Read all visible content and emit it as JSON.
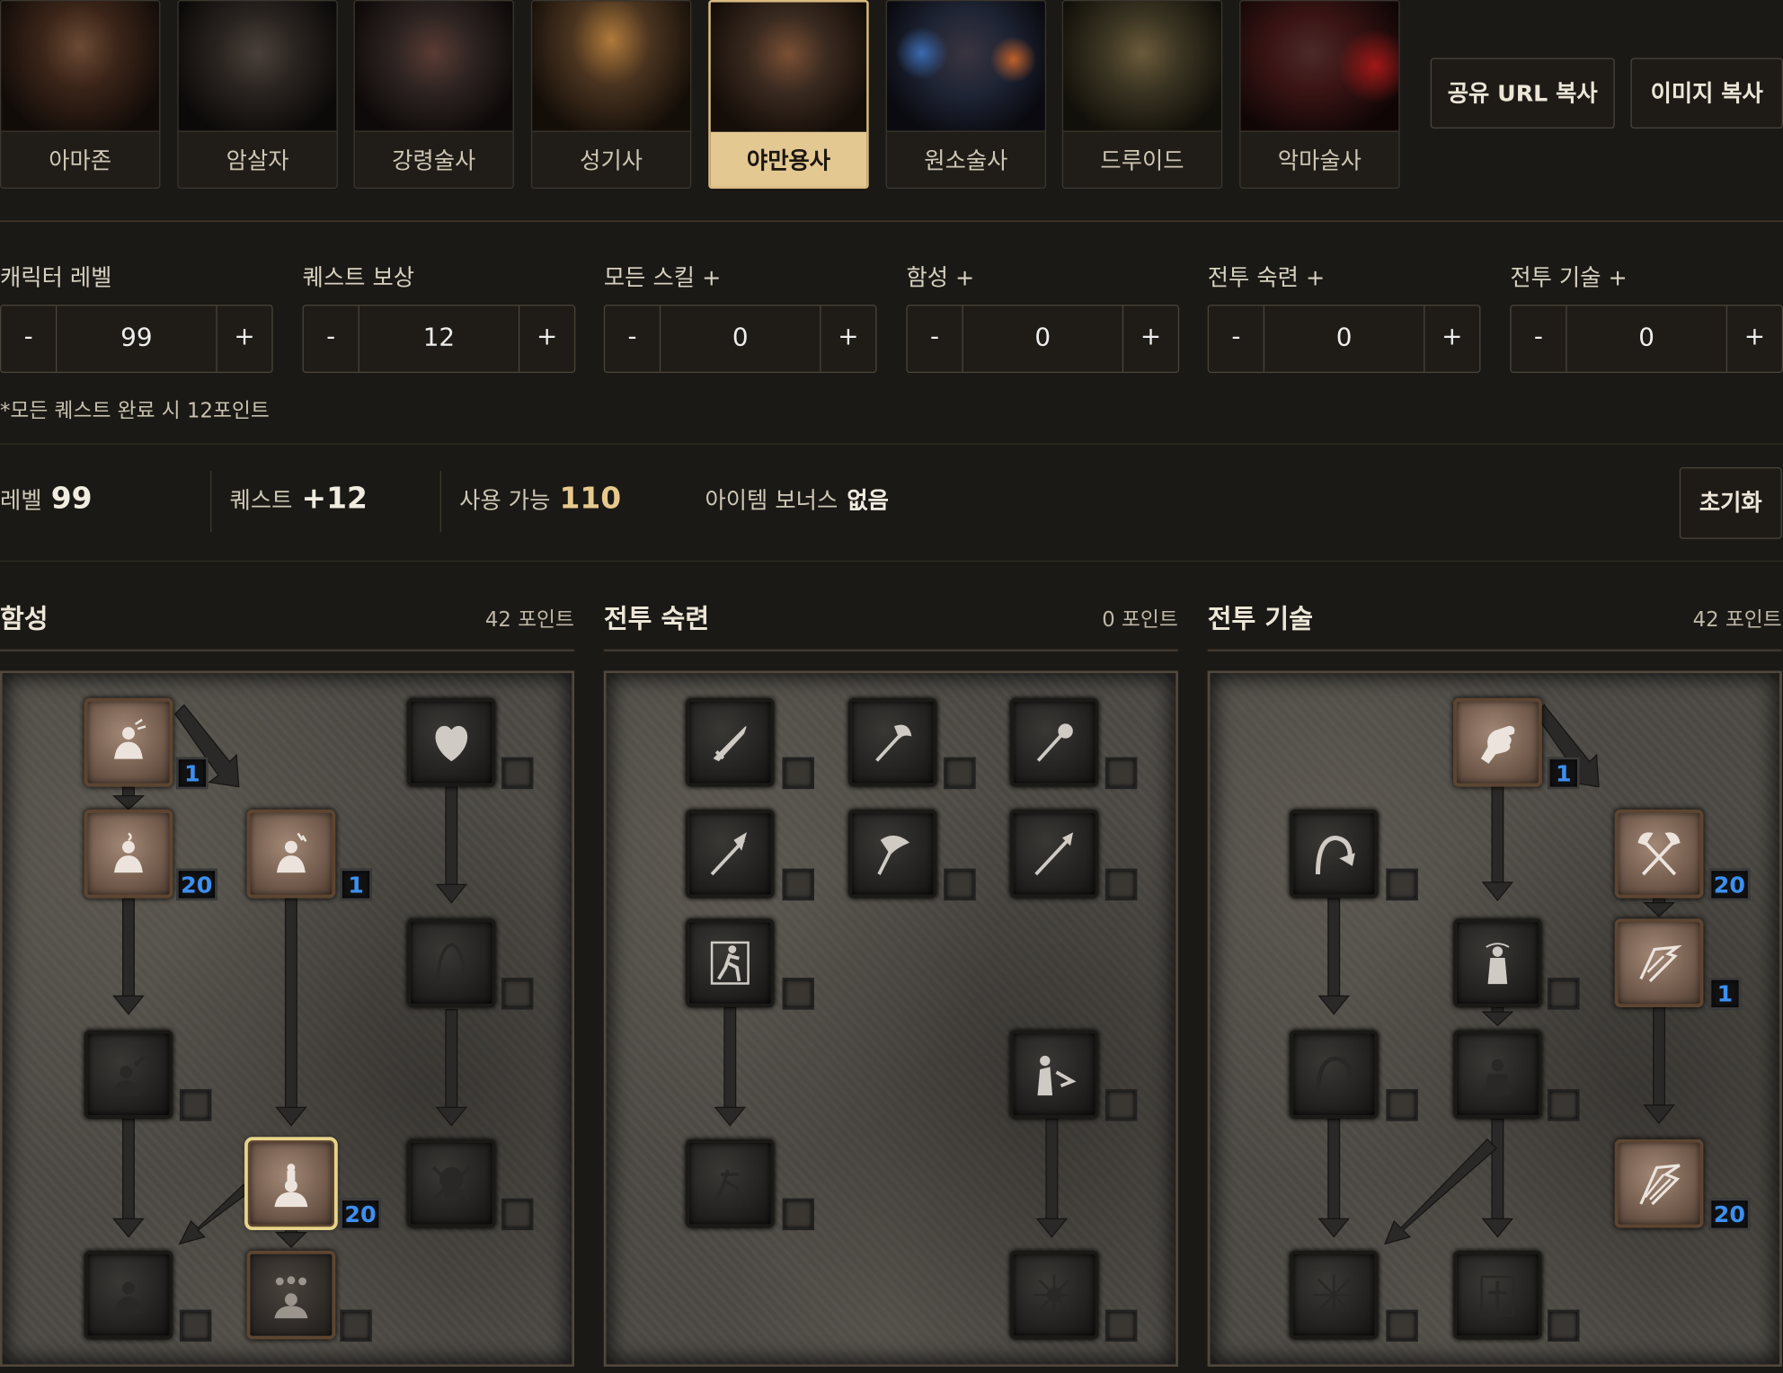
{
  "classes": [
    {
      "name": "아마존",
      "selected": false,
      "tint": "#3a2418"
    },
    {
      "name": "암살자",
      "selected": false,
      "tint": "#2a2420"
    },
    {
      "name": "강령술사",
      "selected": false,
      "tint": "#2e2422"
    },
    {
      "name": "성기사",
      "selected": false,
      "tint": "#4a3420"
    },
    {
      "name": "야만용사",
      "selected": true,
      "tint": "#3a2a20"
    },
    {
      "name": "원소술사",
      "selected": false,
      "tint": "#1e2434"
    },
    {
      "name": "드루이드",
      "selected": false,
      "tint": "#3a3422"
    },
    {
      "name": "악마술사",
      "selected": false,
      "tint": "#3a1414"
    }
  ],
  "header_buttons": {
    "share_url": "공유 URL 복사",
    "copy_image": "이미지 복사"
  },
  "steppers": [
    {
      "label": "캐릭터 레벨",
      "value": "99"
    },
    {
      "label": "퀘스트 보상",
      "value": "12"
    },
    {
      "label": "모든 스킬 +",
      "value": "0"
    },
    {
      "label": "함성 +",
      "value": "0"
    },
    {
      "label": "전투 숙련 +",
      "value": "0"
    },
    {
      "label": "전투 기술 +",
      "value": "0"
    }
  ],
  "stepper_symbols": {
    "minus": "-",
    "plus": "+"
  },
  "quest_note": "*모든 퀘스트 완료 시 12포인트",
  "summary": {
    "level_label": "레벨",
    "level_value": "99",
    "quest_label": "퀘스트",
    "quest_value": "+12",
    "avail_label": "사용 가능",
    "avail_value": "110",
    "item_label": "아이템 보너스",
    "item_value": "없음",
    "reset_label": "초기화"
  },
  "trees": [
    {
      "title": "함성",
      "points": "42 포인트"
    },
    {
      "title": "전투 숙련",
      "points": "0 포인트"
    },
    {
      "title": "전투 기술",
      "points": "42 포인트"
    }
  ],
  "skill_points": {
    "t0": [
      "1",
      "20",
      "1",
      "",
      "",
      "",
      "",
      "20",
      ""
    ],
    "t1": [
      "",
      "",
      "",
      "",
      "",
      "",
      "",
      "",
      "",
      ""
    ],
    "t2": [
      "1",
      "",
      "20",
      "",
      "1",
      "",
      "",
      "20",
      "",
      ""
    ]
  },
  "colors": {
    "gold": "#e6c98c",
    "points_blue": "#3d8ff0",
    "highlight": "#e6d48a"
  }
}
